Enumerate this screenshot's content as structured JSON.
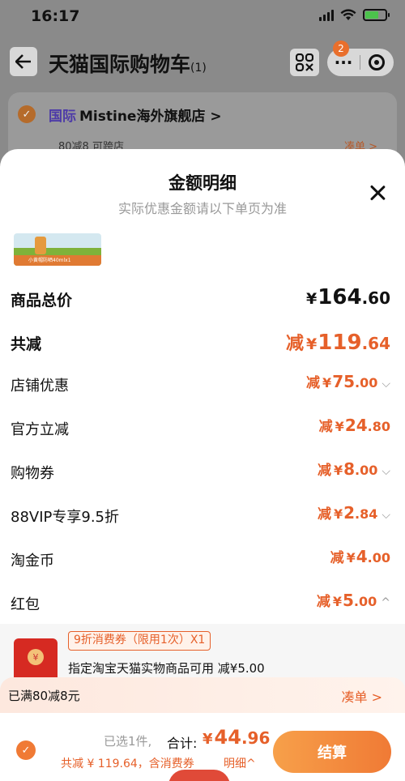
{
  "status_bar": {
    "time": "16:17"
  },
  "nav": {
    "title": "天猫国际购物车",
    "count": "(1)",
    "badge": "2",
    "more": "···"
  },
  "store": {
    "tag": "国际",
    "name": "Mistine海外旗舰店 >",
    "promo": "80减8 可跨店",
    "coudan": "凑单 >"
  },
  "sheet": {
    "title": "金额明细",
    "subtitle": "实际优惠金额请以下单页为准",
    "thumb_label": "小黄帽防晒40mlx1",
    "rows": [
      {
        "label": "商品总价",
        "prefix": "",
        "yen": "¥",
        "int": "164",
        "dec": ".60",
        "chevron": ""
      },
      {
        "label": "共减",
        "prefix": "减",
        "yen": "¥",
        "int": "119",
        "dec": ".64",
        "chevron": ""
      },
      {
        "label": "店铺优惠",
        "prefix": "减",
        "yen": "¥",
        "int": "75",
        "dec": ".00",
        "chevron": "⌵"
      },
      {
        "label": "官方立减",
        "prefix": "减",
        "yen": "¥",
        "int": "24",
        "dec": ".80",
        "chevron": ""
      },
      {
        "label": "购物券",
        "prefix": "减",
        "yen": "¥",
        "int": "8",
        "dec": ".00",
        "chevron": "⌵"
      },
      {
        "label": "88VIP专享9.5折",
        "prefix": "减",
        "yen": "¥",
        "int": "2",
        "dec": ".84",
        "chevron": "⌵"
      },
      {
        "label": "淘金币",
        "prefix": "减",
        "yen": "¥",
        "int": "4",
        "dec": ".00",
        "chevron": ""
      },
      {
        "label": "红包",
        "prefix": "减",
        "yen": "¥",
        "int": "5",
        "dec": ".00",
        "chevron": "^"
      }
    ],
    "coupon": {
      "tag": "9折消费券（限用1次）X1",
      "desc": "指定淘宝天猫实物商品可用   减¥5.00"
    }
  },
  "promo_bar": {
    "left": "已满80减8元",
    "right": "凑单 >"
  },
  "checkout": {
    "selected": "已选1件,",
    "total_label": "合计:",
    "total_yen": "¥",
    "total_int": "44",
    "total_dec": ".96",
    "sub": "共减 ¥ 119.64，含消费券",
    "detail": "明细^",
    "button": "结算"
  }
}
